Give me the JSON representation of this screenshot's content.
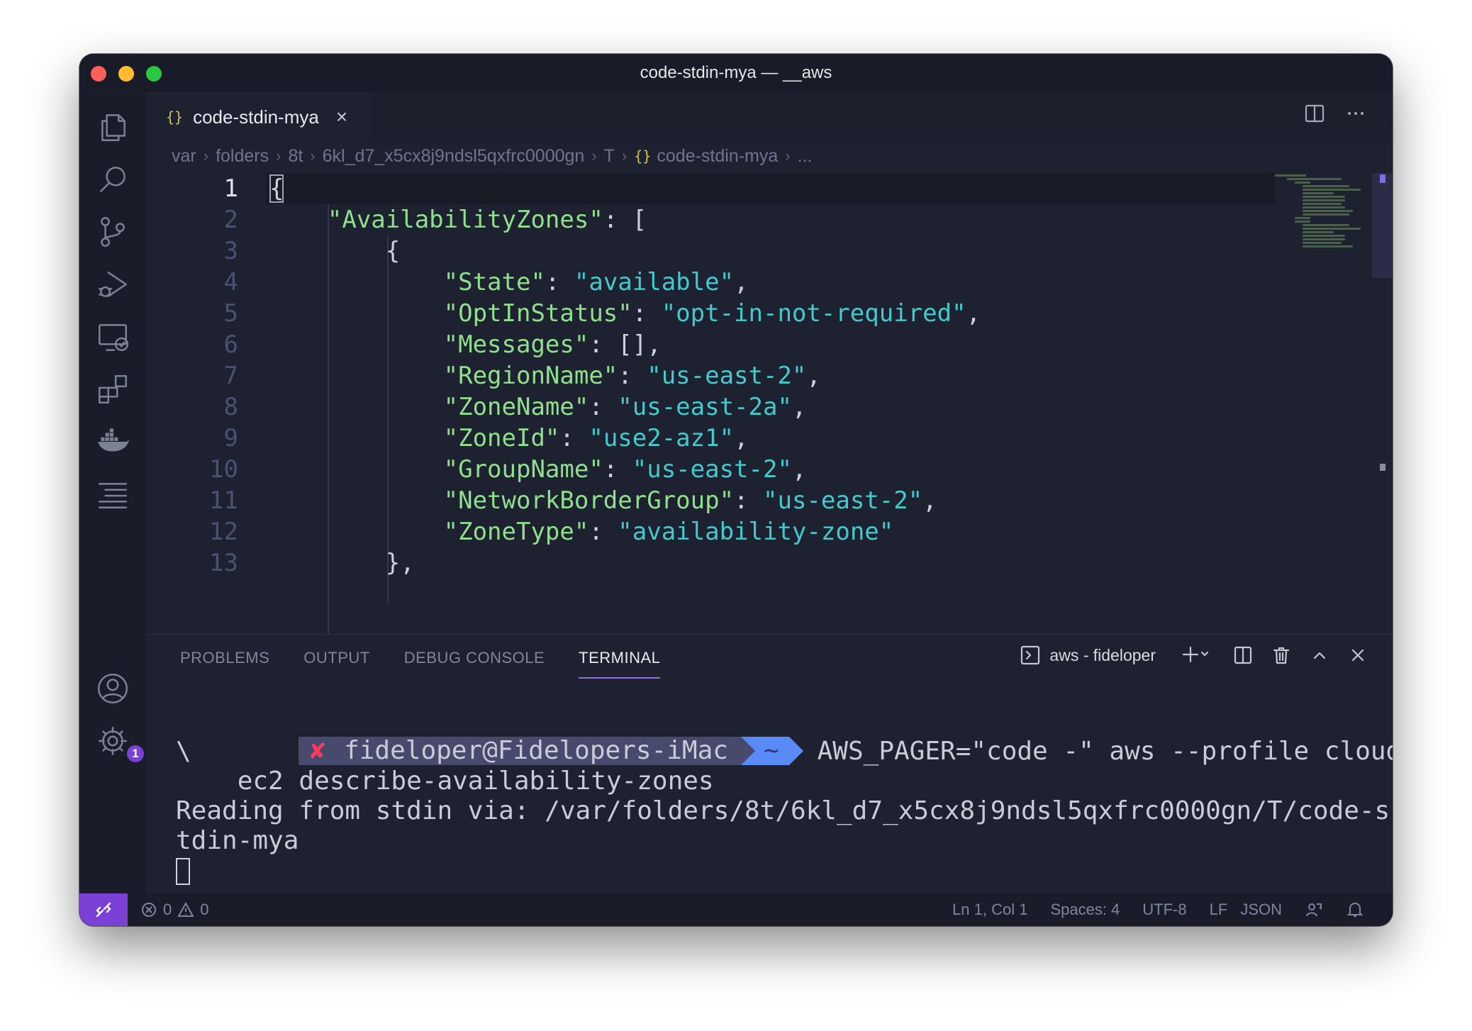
{
  "window": {
    "title": "code-stdin-mya — __aws"
  },
  "tab": {
    "label": "code-stdin-mya",
    "icon": "{}",
    "close": "×"
  },
  "breadcrumbs": [
    "var",
    "folders",
    "8t",
    "6kl_d7_x5cx8j9ndsl5qxfrc0000gn",
    "T",
    "code-stdin-mya",
    "..."
  ],
  "breadcrumb_file_icon": "{}",
  "editor": {
    "line_numbers": [
      "1",
      "2",
      "3",
      "4",
      "5",
      "6",
      "7",
      "8",
      "9",
      "10",
      "11",
      "12",
      "13"
    ],
    "active_line": 1,
    "lines": [
      {
        "indent": "",
        "tokens": [
          [
            "p",
            "{"
          ]
        ]
      },
      {
        "indent": "    ",
        "tokens": [
          [
            "k",
            "\"AvailabilityZones\""
          ],
          [
            "p",
            ": ["
          ]
        ]
      },
      {
        "indent": "        ",
        "tokens": [
          [
            "p",
            "{"
          ]
        ]
      },
      {
        "indent": "            ",
        "tokens": [
          [
            "k",
            "\"State\""
          ],
          [
            "p",
            ": "
          ],
          [
            "s",
            "\"available\""
          ],
          [
            "p",
            ","
          ]
        ]
      },
      {
        "indent": "            ",
        "tokens": [
          [
            "k",
            "\"OptInStatus\""
          ],
          [
            "p",
            ": "
          ],
          [
            "s",
            "\"opt-in-not-required\""
          ],
          [
            "p",
            ","
          ]
        ]
      },
      {
        "indent": "            ",
        "tokens": [
          [
            "k",
            "\"Messages\""
          ],
          [
            "p",
            ": [],"
          ]
        ]
      },
      {
        "indent": "            ",
        "tokens": [
          [
            "k",
            "\"RegionName\""
          ],
          [
            "p",
            ": "
          ],
          [
            "s",
            "\"us-east-2\""
          ],
          [
            "p",
            ","
          ]
        ]
      },
      {
        "indent": "            ",
        "tokens": [
          [
            "k",
            "\"ZoneName\""
          ],
          [
            "p",
            ": "
          ],
          [
            "s",
            "\"us-east-2a\""
          ],
          [
            "p",
            ","
          ]
        ]
      },
      {
        "indent": "            ",
        "tokens": [
          [
            "k",
            "\"ZoneId\""
          ],
          [
            "p",
            ": "
          ],
          [
            "s",
            "\"use2-az1\""
          ],
          [
            "p",
            ","
          ]
        ]
      },
      {
        "indent": "            ",
        "tokens": [
          [
            "k",
            "\"GroupName\""
          ],
          [
            "p",
            ": "
          ],
          [
            "s",
            "\"us-east-2\""
          ],
          [
            "p",
            ","
          ]
        ]
      },
      {
        "indent": "            ",
        "tokens": [
          [
            "k",
            "\"NetworkBorderGroup\""
          ],
          [
            "p",
            ": "
          ],
          [
            "s",
            "\"us-east-2\""
          ],
          [
            "p",
            ","
          ]
        ]
      },
      {
        "indent": "            ",
        "tokens": [
          [
            "k",
            "\"ZoneType\""
          ],
          [
            "p",
            ": "
          ],
          [
            "s",
            "\"availability-zone\""
          ]
        ]
      },
      {
        "indent": "        ",
        "tokens": [
          [
            "p",
            "},"
          ]
        ]
      }
    ]
  },
  "panel": {
    "tabs": [
      "PROBLEMS",
      "OUTPUT",
      "DEBUG CONSOLE",
      "TERMINAL"
    ],
    "active_tab": "TERMINAL",
    "terminal_selector": "aws - fideloper"
  },
  "terminal": {
    "prompt_status": "✘",
    "prompt_user": "fideloper@Fidelopers-iMac",
    "prompt_dir": "~",
    "command": "AWS_PAGER=\"code -\" aws --profile cloudcasts",
    "line2": "\\",
    "line3": "    ec2 describe-availability-zones",
    "line4": "Reading from stdin via: /var/folders/8t/6kl_d7_x5cx8j9ndsl5qxfrc0000gn/T/code-s",
    "line5": "tdin-mya"
  },
  "activity": {
    "settings_badge": "1"
  },
  "status": {
    "errors": "0",
    "warnings": "0",
    "position": "Ln 1, Col 1",
    "spaces": "Spaces: 4",
    "encoding": "UTF-8",
    "eol": "LF",
    "language": "JSON"
  },
  "colors": {
    "accent": "#7b40d6",
    "json_key": "#8fe08c",
    "json_string": "#44c9cd",
    "prompt_segment_1": "#474a6c",
    "prompt_segment_2": "#5a8af5"
  }
}
